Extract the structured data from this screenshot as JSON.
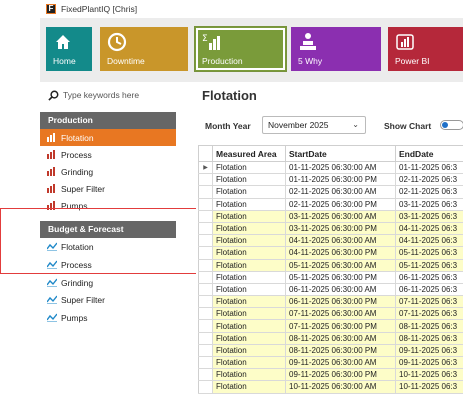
{
  "window": {
    "title": "FixedPlantIQ [Chris]",
    "logo_letter": "F"
  },
  "ribbon": {
    "tiles": [
      {
        "label": "Home",
        "icon": "home-icon",
        "color": "#138a8a"
      },
      {
        "label": "Downtime",
        "icon": "clock-icon",
        "color": "#c9962a"
      },
      {
        "label": "Production",
        "icon": "sigma-bar-chart-icon",
        "color": "#7a9b3a"
      },
      {
        "label": "5 Why",
        "icon": "presenter-icon",
        "color": "#8b2fb0"
      },
      {
        "label": "Power BI",
        "icon": "powerbi-icon",
        "color": "#b5283a"
      }
    ]
  },
  "sidebar": {
    "search_placeholder": "Type keywords here",
    "sections": [
      {
        "title": "Production",
        "items": [
          "Flotation",
          "Process",
          "Grinding",
          "Super Filter",
          "Pumps"
        ],
        "active_index": 0
      },
      {
        "title": "Budget & Forecast",
        "items": [
          "Flotation",
          "Process",
          "Grinding",
          "Super Filter",
          "Pumps"
        ]
      }
    ]
  },
  "main": {
    "title": "Flotation",
    "month_year_label": "Month Year",
    "month_year_value": "November 2025",
    "show_chart_label": "Show Chart",
    "columns": [
      "Measured Area",
      "StartDate",
      "EndDate"
    ],
    "rows": [
      [
        "Flotation",
        "01-11-2025 06:30:00 AM",
        "01-11-2025 06:3"
      ],
      [
        "Flotation",
        "01-11-2025 06:30:00 PM",
        "02-11-2025 06:3"
      ],
      [
        "Flotation",
        "02-11-2025 06:30:00 AM",
        "02-11-2025 06:3"
      ],
      [
        "Flotation",
        "02-11-2025 06:30:00 PM",
        "03-11-2025 06:3"
      ],
      [
        "Flotation",
        "03-11-2025 06:30:00 AM",
        "03-11-2025 06:3"
      ],
      [
        "Flotation",
        "03-11-2025 06:30:00 PM",
        "04-11-2025 06:3"
      ],
      [
        "Flotation",
        "04-11-2025 06:30:00 AM",
        "04-11-2025 06:3"
      ],
      [
        "Flotation",
        "04-11-2025 06:30:00 PM",
        "05-11-2025 06:3"
      ],
      [
        "Flotation",
        "05-11-2025 06:30:00 AM",
        "05-11-2025 06:3"
      ],
      [
        "Flotation",
        "05-11-2025 06:30:00 PM",
        "06-11-2025 06:3"
      ],
      [
        "Flotation",
        "06-11-2025 06:30:00 AM",
        "06-11-2025 06:3"
      ],
      [
        "Flotation",
        "06-11-2025 06:30:00 PM",
        "07-11-2025 06:3"
      ],
      [
        "Flotation",
        "07-11-2025 06:30:00 AM",
        "07-11-2025 06:3"
      ],
      [
        "Flotation",
        "07-11-2025 06:30:00 PM",
        "08-11-2025 06:3"
      ],
      [
        "Flotation",
        "08-11-2025 06:30:00 AM",
        "08-11-2025 06:3"
      ],
      [
        "Flotation",
        "08-11-2025 06:30:00 PM",
        "09-11-2025 06:3"
      ],
      [
        "Flotation",
        "09-11-2025 06:30:00 AM",
        "09-11-2025 06:3"
      ],
      [
        "Flotation",
        "09-11-2025 06:30:00 PM",
        "10-11-2025 06:3"
      ],
      [
        "Flotation",
        "10-11-2025 06:30:00 AM",
        "10-11-2025 06:3"
      ]
    ],
    "row_highlight": [
      "w",
      "w",
      "w",
      "w",
      "y",
      "y",
      "y",
      "y",
      "y",
      "w",
      "w",
      "y",
      "y",
      "y",
      "y",
      "y",
      "y",
      "y",
      "y"
    ],
    "colors": {
      "row_highlight": "#fdfdc8",
      "active_nav": "#e87722",
      "section_header": "#666666",
      "annotation_box": "#e23c3c"
    }
  }
}
